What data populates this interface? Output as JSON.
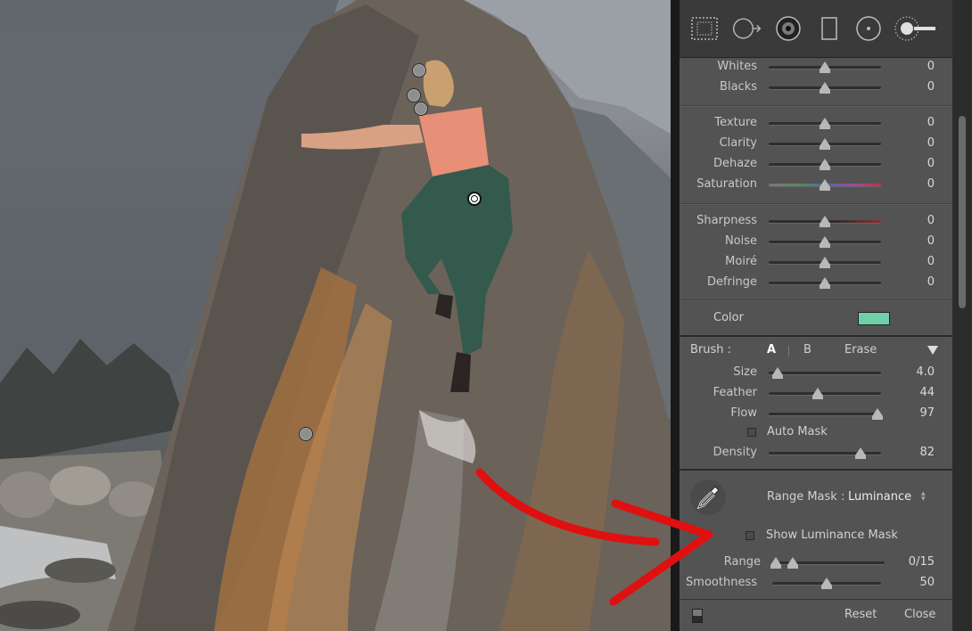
{
  "photo": {
    "pins": [
      {
        "name": "pin-1",
        "active": false
      },
      {
        "name": "pin-2",
        "active": false
      },
      {
        "name": "pin-3",
        "active": false
      },
      {
        "name": "pin-4-active",
        "active": true
      },
      {
        "name": "pin-5",
        "active": false
      }
    ]
  },
  "toolstrip": {
    "tools": [
      "crop-overlay-icon",
      "spot-removal-icon",
      "red-eye-icon",
      "graduated-filter-icon",
      "radial-filter-icon",
      "adjustment-brush-icon"
    ]
  },
  "sliders_group1": [
    {
      "label": "Whites",
      "value": "0",
      "pos": 0.5
    },
    {
      "label": "Blacks",
      "value": "0",
      "pos": 0.5
    }
  ],
  "sliders_group2": [
    {
      "label": "Texture",
      "value": "0",
      "pos": 0.5
    },
    {
      "label": "Clarity",
      "value": "0",
      "pos": 0.5
    },
    {
      "label": "Dehaze",
      "value": "0",
      "pos": 0.5
    },
    {
      "label": "Saturation",
      "value": "0",
      "pos": 0.5
    }
  ],
  "sliders_group3": [
    {
      "label": "Sharpness",
      "value": "0",
      "pos": 0.5
    },
    {
      "label": "Noise",
      "value": "0",
      "pos": 0.5
    },
    {
      "label": "Moiré",
      "value": "0",
      "pos": 0.5
    },
    {
      "label": "Defringe",
      "value": "0",
      "pos": 0.5
    }
  ],
  "color": {
    "label": "Color",
    "swatch": "#6fcfa9"
  },
  "brush": {
    "label": "Brush :",
    "tab_a": "A",
    "tab_b": "B",
    "erase": "Erase",
    "sliders": [
      {
        "label": "Size",
        "value": "4.0",
        "pos": 0.08
      },
      {
        "label": "Feather",
        "value": "44",
        "pos": 0.44
      },
      {
        "label": "Flow",
        "value": "97",
        "pos": 0.97
      }
    ],
    "auto_mask": "Auto Mask",
    "density": {
      "label": "Density",
      "value": "82",
      "pos": 0.82
    }
  },
  "range_mask": {
    "label": "Range Mask :",
    "mode": "Luminance",
    "show_mask": "Show Luminance Mask",
    "range": {
      "label": "Range",
      "value": "0/15",
      "low": 0.0,
      "high": 0.15
    },
    "smoothness": {
      "label": "Smoothness",
      "value": "50",
      "pos": 0.5
    }
  },
  "footer": {
    "reset": "Reset",
    "close": "Close"
  }
}
